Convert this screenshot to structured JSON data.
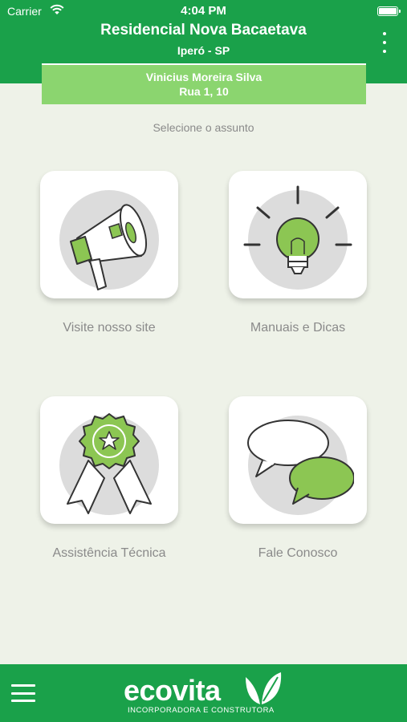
{
  "status_bar": {
    "carrier": "Carrier",
    "time": "4:04 PM"
  },
  "header": {
    "title": "Residencial Nova Bacaetava",
    "subtitle": "Iperó - SP",
    "user_name": "Vinicius Moreira Silva",
    "user_address": "Rua 1, 10"
  },
  "main": {
    "prompt": "Selecione o assunto",
    "tiles": [
      {
        "label": "Visite nosso site",
        "icon": "megaphone-icon"
      },
      {
        "label": "Manuais e Dicas",
        "icon": "lightbulb-icon"
      },
      {
        "label": "Assistência Técnica",
        "icon": "award-ribbon-icon"
      },
      {
        "label": "Fale Conosco",
        "icon": "chat-bubbles-icon"
      }
    ]
  },
  "footer": {
    "logo_text": "ecovita",
    "logo_tagline": "INCORPORADORA E CONSTRUTORA"
  },
  "colors": {
    "primary_green": "#1aa14a",
    "light_green": "#8bd56f",
    "icon_green": "#8cc653",
    "background": "#eef2e8"
  }
}
